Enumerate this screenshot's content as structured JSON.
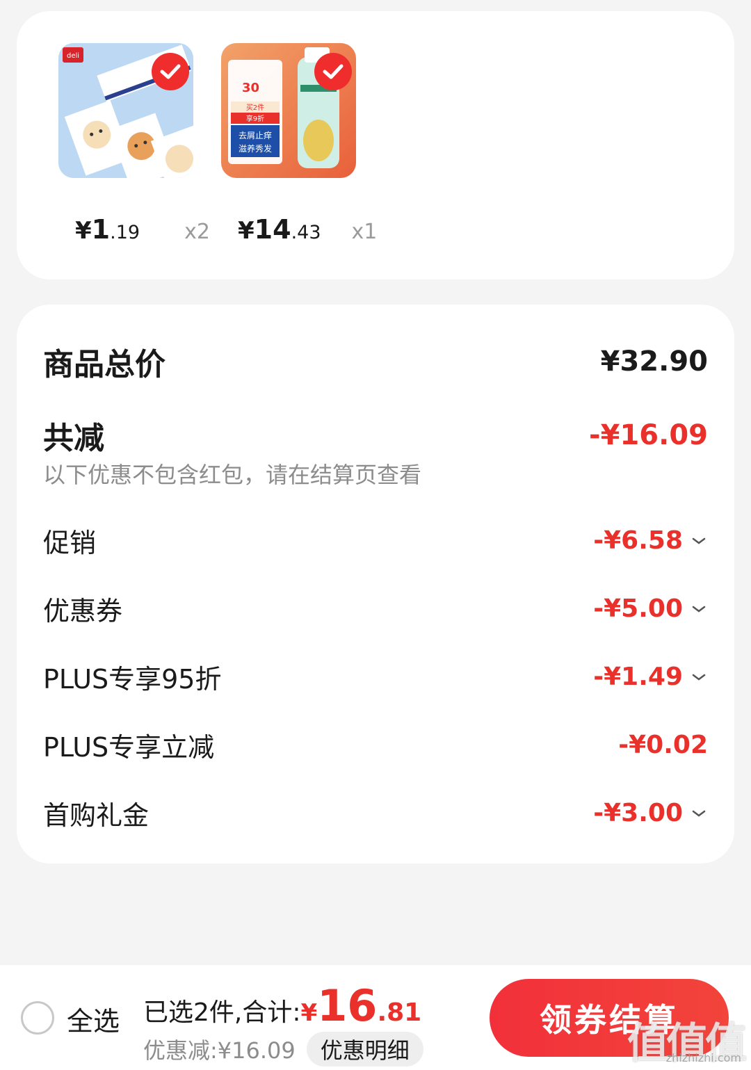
{
  "products": [
    {
      "name": "deli-bear-stationery",
      "brand_text": "deli",
      "price_yen": "¥",
      "price_int": "1",
      "price_dec": ".19",
      "quantity": "x2",
      "selected": true
    },
    {
      "name": "shampoo-bottle",
      "price_yen": "¥",
      "price_int": "14",
      "price_dec": ".43",
      "quantity": "x1",
      "selected": true,
      "promo_texts": [
        "30",
        "买2件",
        "享9折",
        "去屑止痒",
        "滋养秀发"
      ]
    }
  ],
  "summary": {
    "total_label": "商品总价",
    "total_value": "¥32.90",
    "reduce_label": "共减",
    "reduce_value": "-¥16.09",
    "note": "以下优惠不包含红包，请在结算页查看",
    "items": [
      {
        "label": "促销",
        "value": "-¥6.58",
        "expandable": true
      },
      {
        "label": "优惠券",
        "value": "-¥5.00",
        "expandable": true
      },
      {
        "label": "PLUS专享95折",
        "value": "-¥1.49",
        "expandable": true
      },
      {
        "label": "PLUS专享立减",
        "value": "-¥0.02",
        "expandable": false
      },
      {
        "label": "首购礼金",
        "value": "-¥3.00",
        "expandable": true
      }
    ]
  },
  "bottom_bar": {
    "select_all": "全选",
    "selected_count_label": "已选2件,合计:",
    "total_yen": "¥",
    "total_int": "16",
    "total_dec": ".81",
    "discount_text": "优惠减:¥16.09",
    "detail_button": "优惠明细",
    "checkout_button": "领券结算",
    "watermark": "值值值",
    "watermark_site": "zhizhizhi.com"
  },
  "colors": {
    "accent_red": "#e9302a",
    "button_red": "#f2303a",
    "background": "#f4f4f4"
  }
}
